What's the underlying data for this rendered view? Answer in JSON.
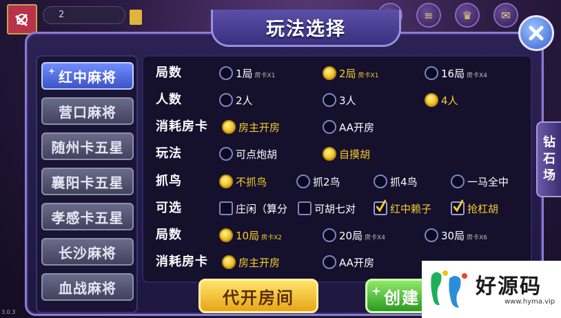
{
  "top": {
    "name": "2",
    "version": "3.0.3"
  },
  "title": "玩法选择",
  "menu": [
    "红中麻将",
    "营口麻将",
    "随州卡五星",
    "襄阳卡五星",
    "孝感卡五星",
    "长沙麻将",
    "血战麻将"
  ],
  "rows": [
    {
      "label": "局数",
      "options": [
        {
          "text": "1局",
          "sub": "房卡X1",
          "selected": false,
          "type": "radio"
        },
        {
          "text": "2局",
          "sub": "房卡X1",
          "selected": true,
          "type": "radio"
        },
        {
          "text": "16局",
          "sub": "房卡X4",
          "selected": false,
          "type": "radio"
        }
      ]
    },
    {
      "label": "人数",
      "options": [
        {
          "text": "2人",
          "sub": "",
          "selected": false,
          "type": "radio"
        },
        {
          "text": "3人",
          "sub": "",
          "selected": false,
          "type": "radio"
        },
        {
          "text": "4人",
          "sub": "",
          "selected": true,
          "type": "radio"
        }
      ]
    },
    {
      "label": "消耗房卡",
      "options": [
        {
          "text": "房主开房",
          "sub": "",
          "selected": true,
          "type": "radio"
        },
        {
          "text": "AA开房",
          "sub": "",
          "selected": false,
          "type": "radio"
        }
      ]
    },
    {
      "label": "玩法",
      "options": [
        {
          "text": "可点炮胡",
          "sub": "",
          "selected": false,
          "type": "radio"
        },
        {
          "text": "自摸胡",
          "sub": "",
          "selected": true,
          "type": "radio"
        }
      ]
    },
    {
      "label": "抓鸟",
      "options": [
        {
          "text": "不抓鸟",
          "sub": "",
          "selected": true,
          "type": "radio"
        },
        {
          "text": "抓2鸟",
          "sub": "",
          "selected": false,
          "type": "radio"
        },
        {
          "text": "抓4鸟",
          "sub": "",
          "selected": false,
          "type": "radio"
        },
        {
          "text": "一马全中",
          "sub": "",
          "selected": false,
          "type": "radio"
        }
      ]
    },
    {
      "label": "可选",
      "options": [
        {
          "text": "庄闲（算分",
          "sub": "",
          "selected": false,
          "type": "check"
        },
        {
          "text": "可胡七对",
          "sub": "",
          "selected": false,
          "type": "check"
        },
        {
          "text": "红中赖子",
          "sub": "",
          "selected": true,
          "type": "check"
        },
        {
          "text": "抢杠胡",
          "sub": "",
          "selected": true,
          "type": "check"
        }
      ]
    },
    {
      "label": "局数",
      "options": [
        {
          "text": "10局",
          "sub": "房卡X2",
          "selected": true,
          "type": "radio"
        },
        {
          "text": "20局",
          "sub": "房卡X4",
          "selected": false,
          "type": "radio"
        },
        {
          "text": "30局",
          "sub": "房卡X6",
          "selected": false,
          "type": "radio"
        }
      ]
    },
    {
      "label": "消耗房卡",
      "options": [
        {
          "text": "房主开房",
          "sub": "",
          "selected": true,
          "type": "radio"
        },
        {
          "text": "AA开房",
          "sub": "",
          "selected": false,
          "type": "radio"
        }
      ]
    }
  ],
  "buttons": {
    "proxy": "代开房间",
    "create": "创建"
  },
  "side_tab": "钻石场",
  "watermark": {
    "text": "好源码",
    "url": "www.hyma.vip"
  },
  "colors": {
    "selected": "#f6cc29",
    "active_menu": "#5b74e8"
  }
}
